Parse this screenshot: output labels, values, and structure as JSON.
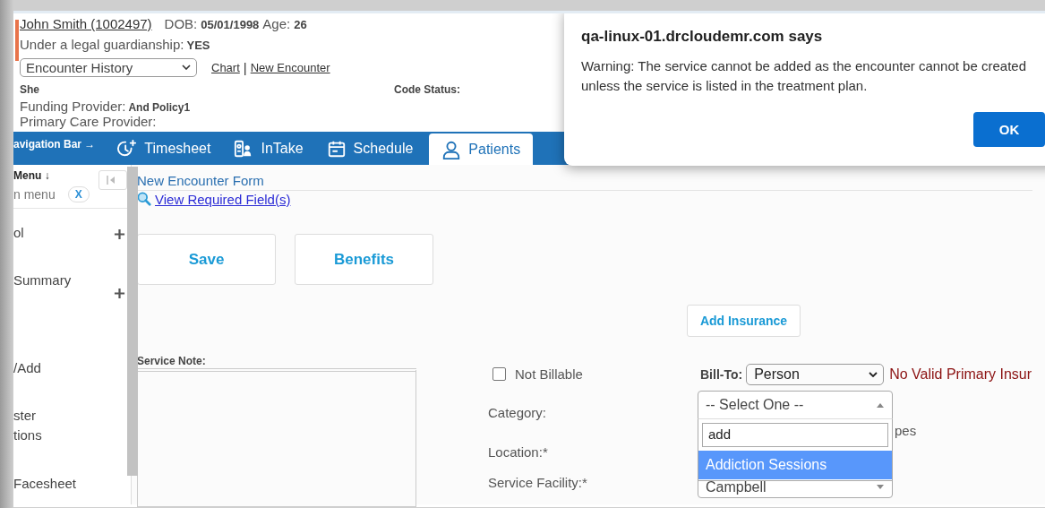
{
  "patient": {
    "name": "John Smith (1002497)",
    "dob_label": "DOB:",
    "dob": "05/01/1998",
    "age_label": "Age:",
    "age": "26",
    "guardianship_label": "Under a legal guardianship:",
    "guardianship": "YES",
    "history_select": "Encounter History",
    "links": [
      "Chart",
      "New Encounter"
    ],
    "link_separator": "|",
    "pronoun": "She",
    "code_status_label": "Code Status:",
    "funding_label": "Funding Provider:",
    "funding": "And Policy1",
    "pcp_label": "Primary Care Provider:"
  },
  "nav": {
    "label": "avigation Bar →",
    "tabs": [
      {
        "label": "Timesheet",
        "kind": "clock",
        "selected": false
      },
      {
        "label": "InTake",
        "kind": "card",
        "selected": false
      },
      {
        "label": "Schedule",
        "kind": "calendar",
        "selected": false
      },
      {
        "label": "Patients",
        "kind": "person",
        "selected": true
      }
    ]
  },
  "sidebar": {
    "title": "Menu ↓",
    "search_placeholder": "n menu",
    "clear": "X",
    "items": [
      {
        "label": "ol",
        "expandable": true
      },
      {
        "label": "Summary",
        "expandable": true
      },
      {
        "label": "/Add",
        "expandable": false
      },
      {
        "label": "ster\ntions",
        "expandable": false
      },
      {
        "label": "Facesheet",
        "expandable": false
      }
    ]
  },
  "form": {
    "title": "New Encounter Form",
    "required_link": "View Required Field(s)",
    "buttons": [
      "Save",
      "Benefits"
    ],
    "add_insurance": "Add Insurance",
    "service_note_label": "Service Note:",
    "not_billable": {
      "label": "Not Billable",
      "checked": false
    },
    "category_label": "Category:",
    "location_label": "Location:*",
    "facility_label": "Service Facility:*",
    "bill_to_label": "Bill-To:",
    "bill_to": "Person",
    "insurance_warning": "No Valid Primary Insur",
    "category_dropdown": {
      "value": "-- Select One --",
      "search": "add",
      "options": [
        {
          "label": "Addiction Sessions",
          "selected": true
        }
      ]
    },
    "types_fragment": "pes",
    "facility": "Campbell"
  },
  "dialog": {
    "title": "qa-linux-01.drcloudemr.com says",
    "message": "Warning: The service cannot be added as the encounter cannot be created unless the service is listed in the treatment plan.",
    "button": "OK"
  }
}
